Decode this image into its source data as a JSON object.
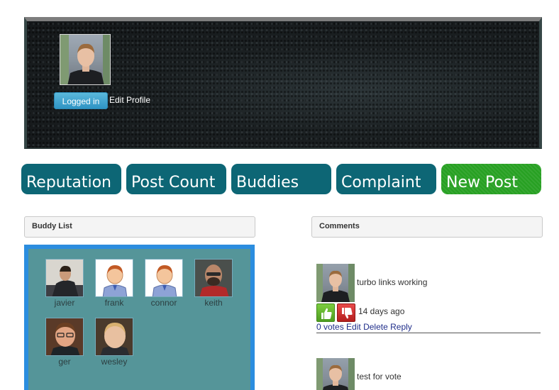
{
  "banner": {
    "logged_in_label": "Logged in",
    "edit_profile_label": "Edit Profile"
  },
  "tabs": [
    {
      "label": "Reputation",
      "color": "#0d6675"
    },
    {
      "label": "Post Count",
      "color": "#0d6675"
    },
    {
      "label": "Buddies",
      "color": "#0d6675"
    },
    {
      "label": "Complaint",
      "color": "#0d6675"
    },
    {
      "label": "New Post",
      "color": "#27a022"
    }
  ],
  "buddy_list": {
    "title": "Buddy List",
    "buddies": [
      {
        "name": "javier",
        "avatar": "photo"
      },
      {
        "name": "frank",
        "avatar": "default-person-icon"
      },
      {
        "name": "connor",
        "avatar": "default-person-icon"
      },
      {
        "name": "keith",
        "avatar": "photo"
      },
      {
        "name": "ger",
        "avatar": "photo"
      },
      {
        "name": "wesley",
        "avatar": "photo"
      }
    ]
  },
  "comments": {
    "title": "Comments",
    "items": [
      {
        "text": "turbo links working",
        "time": "14 days ago",
        "votes": "0 votes",
        "edit": "Edit",
        "delete": "Delete",
        "reply": "Reply"
      },
      {
        "text": "test for vote"
      }
    ]
  },
  "colors": {
    "tab_teal": "#0d6675",
    "tab_green": "#27a022",
    "buddy_panel": "#559599",
    "buddy_panel_border": "#2b8ddf",
    "logged_in_button": "#2f94c4",
    "link": "#1f2d8a"
  }
}
